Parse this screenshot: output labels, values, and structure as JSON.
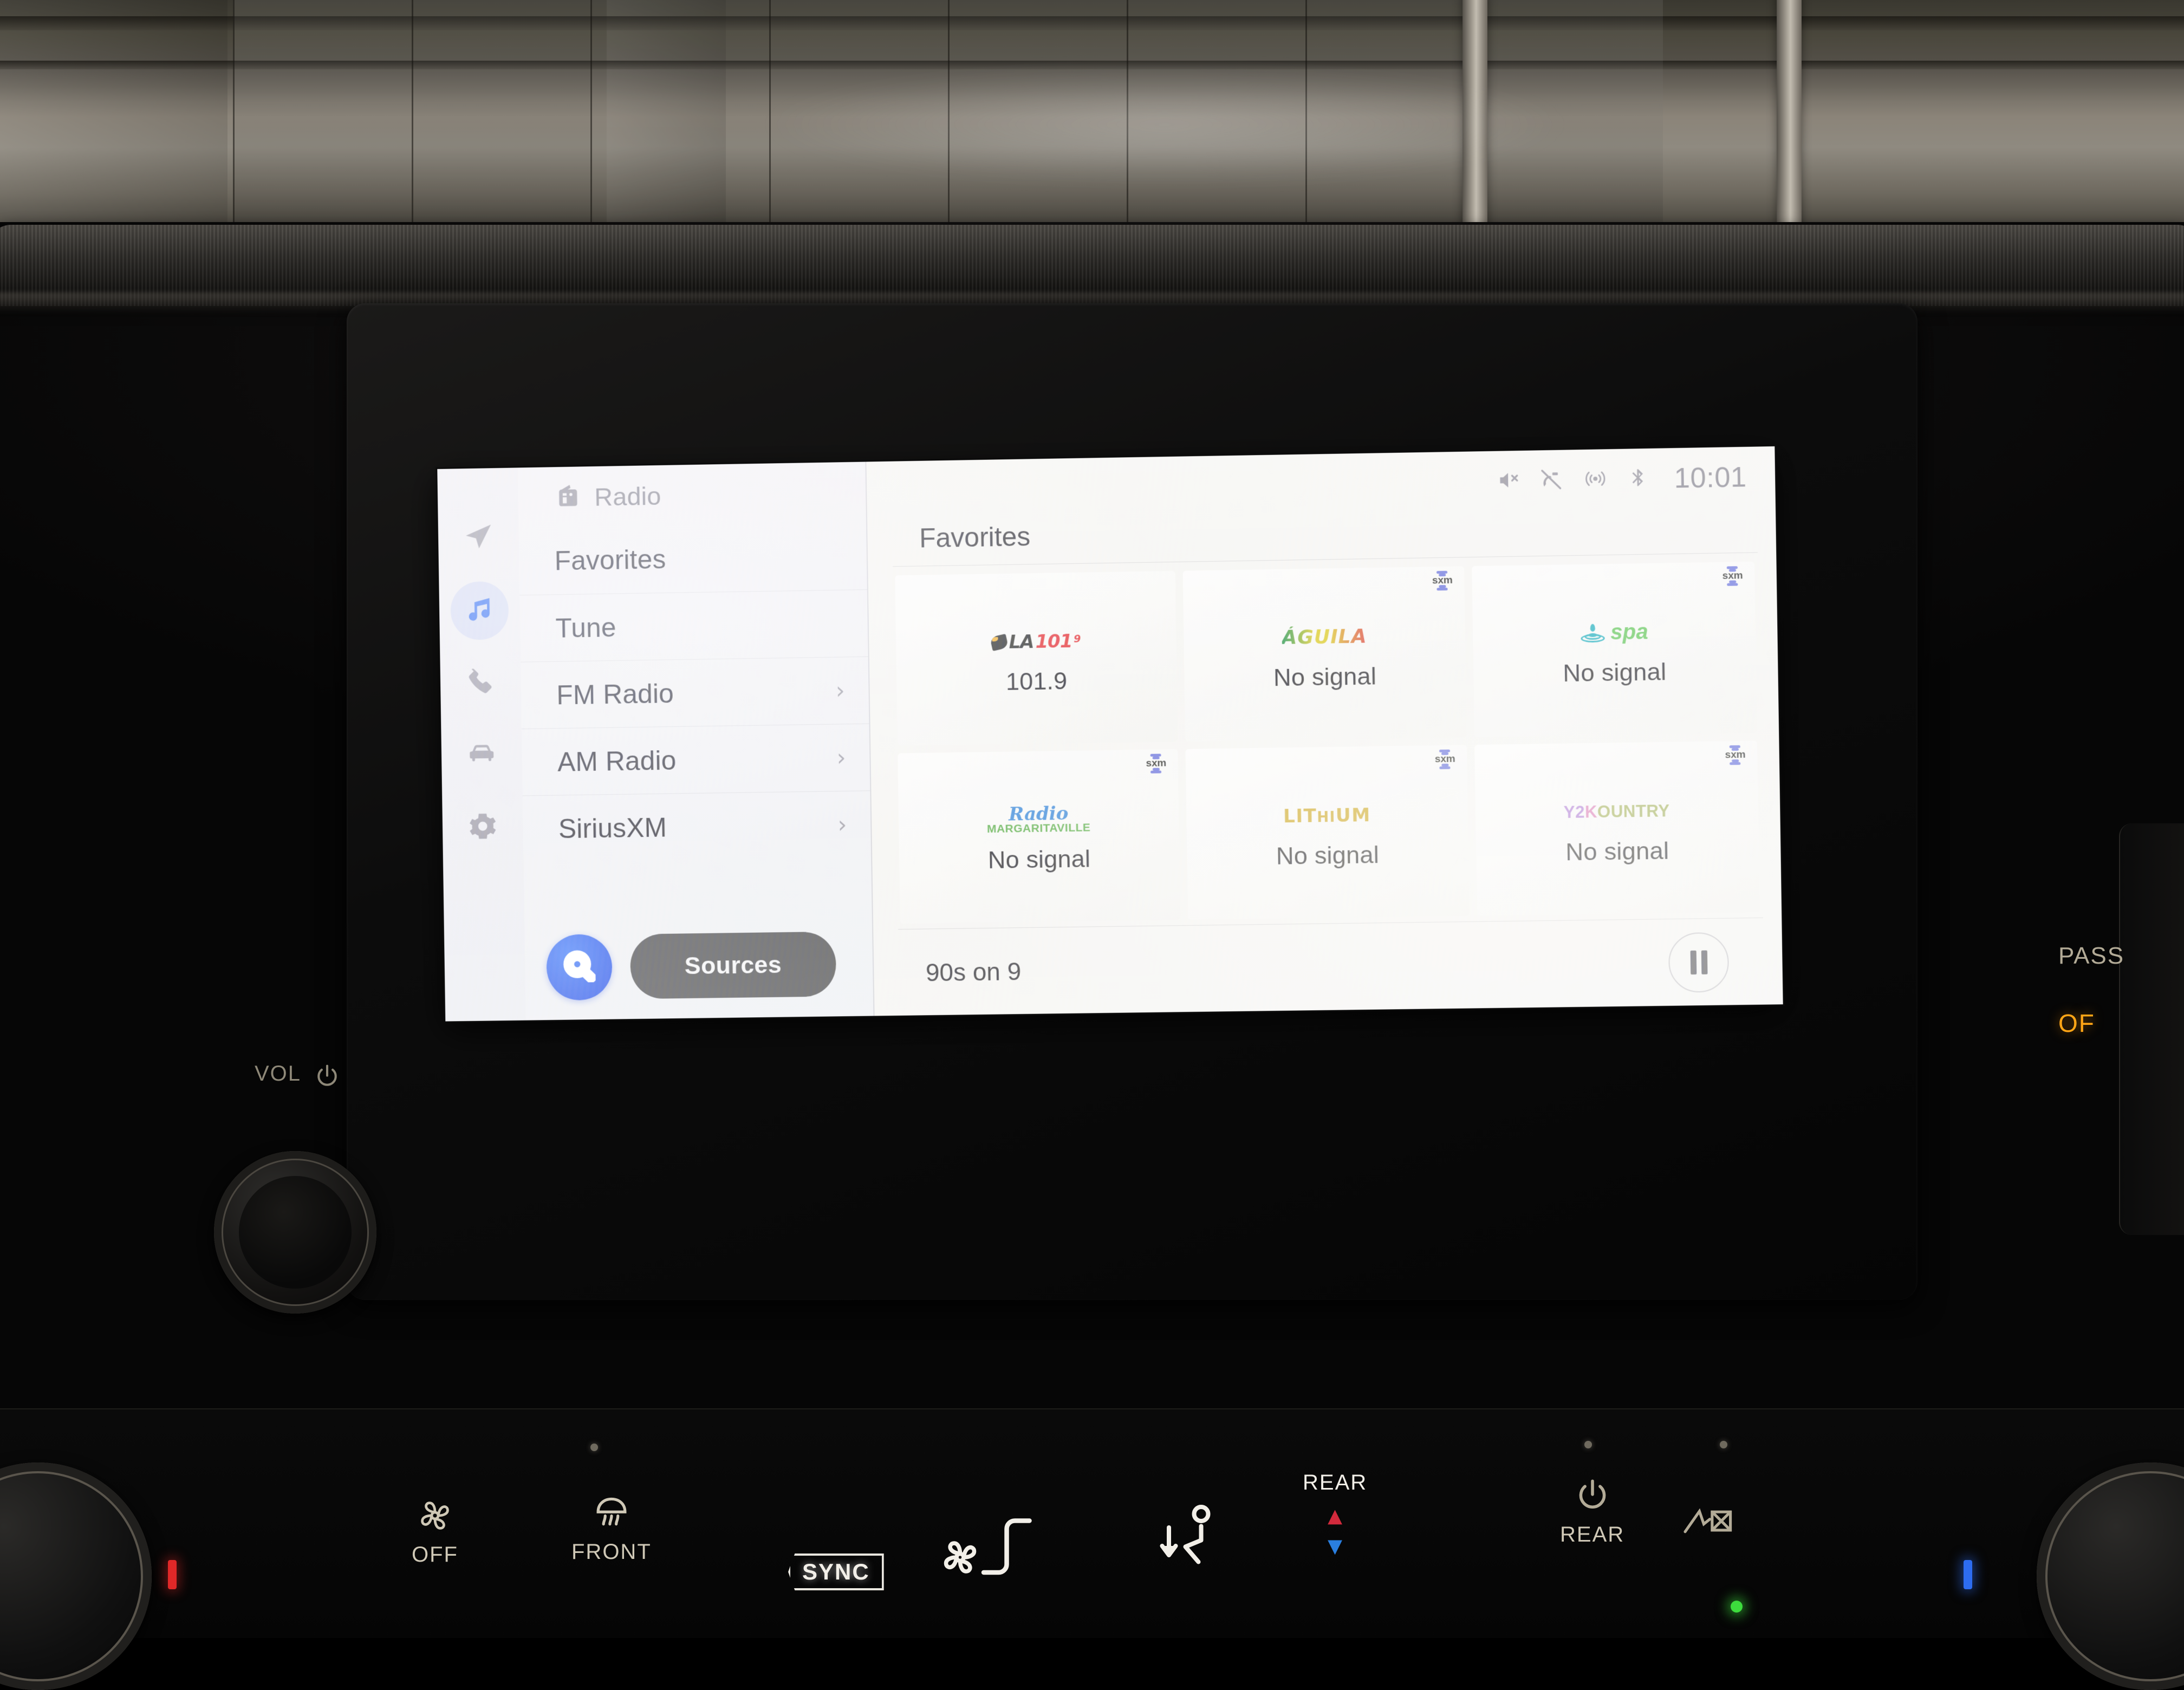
{
  "screen": {
    "header": {
      "source_icon": "radio-icon",
      "source_label": "Radio"
    },
    "status_bar": {
      "icons": [
        "mute-icon",
        "satellite-off-icon",
        "broadcast-icon",
        "bluetooth-icon"
      ],
      "clock": "10:01"
    },
    "rail": {
      "items": [
        {
          "name": "navigation-icon",
          "label": "Navigation",
          "active": false
        },
        {
          "name": "music-icon",
          "label": "Audio",
          "active": true
        },
        {
          "name": "phone-icon",
          "label": "Phone",
          "active": false
        },
        {
          "name": "vehicle-icon",
          "label": "Vehicle",
          "active": false
        },
        {
          "name": "settings-gear-icon",
          "label": "Settings",
          "active": false
        }
      ]
    },
    "menu": {
      "items": [
        {
          "label": "Favorites",
          "chevron": ""
        },
        {
          "label": "Tune",
          "chevron": ""
        },
        {
          "label": "FM Radio",
          "chevron": "›"
        },
        {
          "label": "AM Radio",
          "chevron": "›"
        },
        {
          "label": "SiriusXM",
          "chevron": "›"
        }
      ],
      "search_label": "Search",
      "sources_label": "Sources"
    },
    "favorites": {
      "title": "Favorites",
      "sxm_badge_text": "sxm",
      "tiles": [
        {
          "logo_type": "la1019",
          "logo_text": "LA 101.9",
          "logo_parts": {
            "la": "LA",
            "num": "101",
            "sup": "9"
          },
          "caption": "101.9",
          "sxm": false
        },
        {
          "logo_type": "aguila",
          "logo_text": "ÁGUILA",
          "caption": "No signal",
          "sxm": true
        },
        {
          "logo_type": "spa",
          "logo_text": "spa",
          "caption": "No signal",
          "sxm": true
        },
        {
          "logo_type": "margaritaville",
          "logo_text": "Radio MARGARITAVILLE",
          "logo_parts": {
            "line1": "Radio",
            "line2": "MARGARITAVILLE"
          },
          "caption": "No signal",
          "sxm": true
        },
        {
          "logo_type": "lithium",
          "logo_text": "LITHIUM",
          "logo_parts": {
            "a": "L",
            "b": "I",
            "c": "T",
            "d": "H",
            "e": "I",
            "f": "U",
            "g": "M"
          },
          "caption": "No signal",
          "sxm": true
        },
        {
          "logo_type": "y2kountry",
          "logo_text": "Y2KOUNTRY",
          "logo_parts": {
            "y2": "Y2",
            "k": "K",
            "ountry": "OUNTRY"
          },
          "caption": "No signal",
          "sxm": true
        }
      ]
    },
    "now_playing": {
      "station": "90s on 9",
      "transport": "pause-button"
    },
    "colors": {
      "accent_blue": "#1445e8",
      "rail_active_bg": "#cfd5f0",
      "sources_bg": "#3a3a3c",
      "screen_bg": "#f4f3f0"
    }
  },
  "hardware": {
    "volume": {
      "label": "VOL",
      "power_icon": "power-icon"
    },
    "passenger_airbag": {
      "label": "PASS",
      "status": "OF"
    },
    "climate": {
      "fan_off": {
        "label": "OFF",
        "icon": "fan-icon"
      },
      "defrost_front": {
        "label": "FRONT",
        "icon": "front-defrost-icon"
      },
      "sync": {
        "label": "SYNC"
      },
      "recirculate": {
        "icon": "recirculate-fan-icon"
      },
      "airflow": {
        "icon": "airflow-seat-icon"
      },
      "rear_temp": {
        "label": "REAR",
        "up": "▲",
        "down": "▼"
      },
      "rear_power": {
        "label": "REAR",
        "icon": "power-icon"
      }
    }
  }
}
